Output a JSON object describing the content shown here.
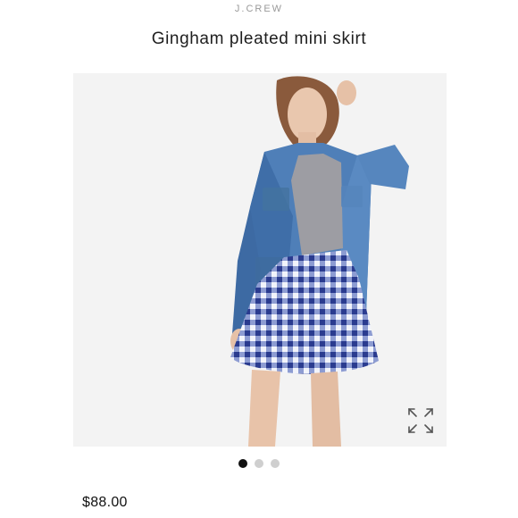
{
  "header": {
    "brand": "J.CREW",
    "product_title": "Gingham pleated mini skirt"
  },
  "gallery": {
    "image_subject": "product-photo",
    "expand_icon": "expand-arrows-icon",
    "total_images": 3,
    "active_index": 0
  },
  "product": {
    "price": "$88.00"
  },
  "colors": {
    "background": "#ffffff",
    "photo_background": "#f3f3f3",
    "dot_active": "#111111",
    "dot_inactive": "#cfcfcf"
  }
}
